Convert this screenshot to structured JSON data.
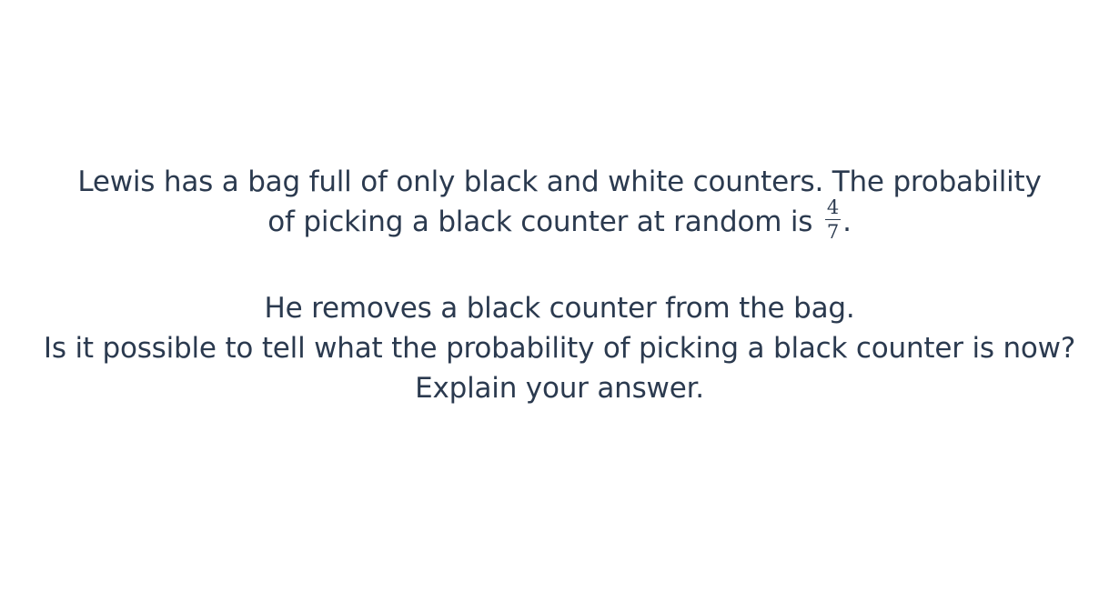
{
  "question": {
    "paragraph1": {
      "line1": "Lewis has a bag full of only black and white counters. The probability",
      "line2_before": "of picking a black counter at random is",
      "fraction": {
        "numerator": "4",
        "denominator": "7"
      },
      "line2_after": "."
    },
    "paragraph2": {
      "line1": "He removes a black counter from the bag.",
      "line2": "Is it possible to tell what the probability of picking a black counter is now?",
      "line3": "Explain your answer."
    }
  }
}
